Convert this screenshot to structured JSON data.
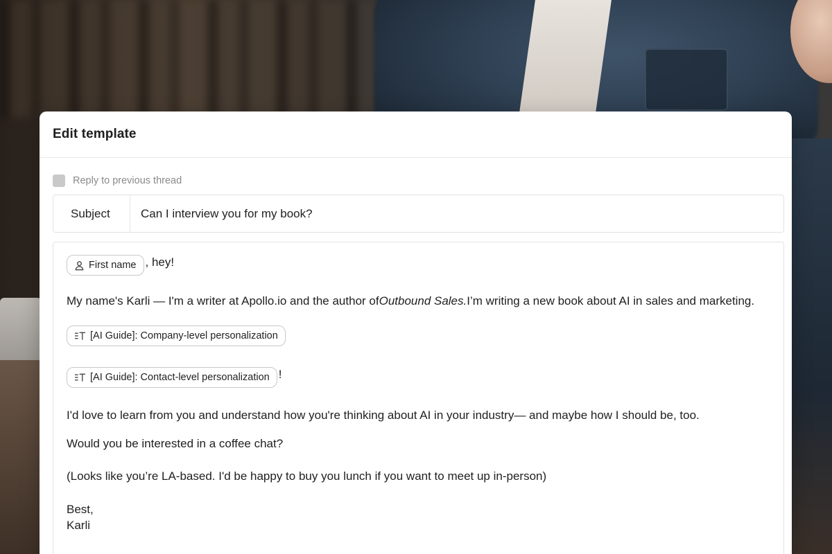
{
  "modal": {
    "title": "Edit template"
  },
  "reply": {
    "label": "Reply to previous thread",
    "checked": false
  },
  "subject": {
    "label": "Subject",
    "value": "Can I interview you for my book?"
  },
  "body": {
    "greeting_chip": "First name",
    "greeting_suffix": ", hey!",
    "intro_before": "My name's Karli — I'm a writer at Apollo.io and the author of ",
    "intro_italic": "Outbound Sales.",
    "intro_after": " I’m writing a new book about AI in sales and marketing.",
    "ai_chip_company": "[AI Guide]: Company-level personalization",
    "ai_chip_contact": "[AI Guide]: Contact-level personalization",
    "ai_chip_contact_suffix": "!",
    "love": "I'd love to learn from you and understand how you're thinking about AI in your industry— and maybe how I should be, too.",
    "coffee": "Would you be interested in a coffee chat?",
    "la": "(Looks like you’re LA-based. I'd be happy to buy you lunch if you want to meet up in-person)",
    "signoff": "Best,",
    "signature": "Karli"
  },
  "icons": {
    "first_name_chip": "user-icon",
    "ai_chip": "ai-text-icon"
  },
  "colors": {
    "checkbox": "#c9c9c9",
    "border": "#e3e3e3",
    "chip_border": "#c9c9c9",
    "muted_text": "#8a8a8a"
  }
}
